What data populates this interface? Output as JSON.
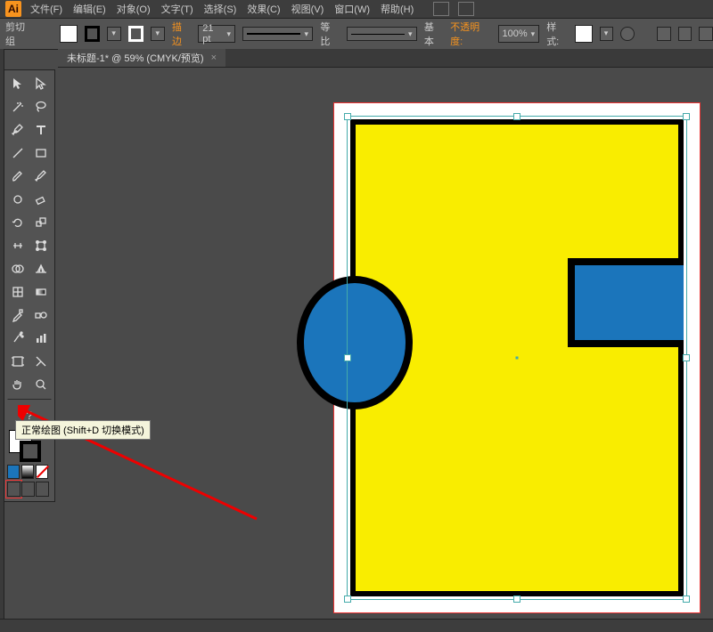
{
  "colors": {
    "accent": "#f7931e",
    "artboard_outline": "#e33",
    "shape_fill_yellow": "#f9ed00",
    "shape_fill_blue": "#1b75bb",
    "shape_stroke": "#000000"
  },
  "menubar": {
    "logo_text": "Ai",
    "items": [
      "文件(F)",
      "编辑(E)",
      "对象(O)",
      "文字(T)",
      "选择(S)",
      "效果(C)",
      "视图(V)",
      "窗口(W)",
      "帮助(H)"
    ]
  },
  "optbar": {
    "group_label": "剪切组",
    "stroke_label": "描边",
    "stroke_weight": "21 pt",
    "uniform_label": "等比",
    "basic_label": "基本",
    "opacity_label": "不透明度:",
    "opacity_value": "100%",
    "style_label": "样式:"
  },
  "document_tab": {
    "title": "未标题-1* @ 59% (CMYK/预览)"
  },
  "tooltip": {
    "text": "正常绘图 (Shift+D 切换模式)"
  },
  "tools_left": [
    "selection",
    "direct-selection",
    "magic-wand",
    "lasso",
    "pen",
    "type",
    "line",
    "rectangle",
    "paintbrush",
    "pencil",
    "blob-brush",
    "eraser",
    "rotate",
    "scale",
    "width",
    "free-transform",
    "shape-builder",
    "perspective-grid",
    "mesh",
    "gradient",
    "eyedropper",
    "blend",
    "symbol-sprayer",
    "column-graph",
    "artboard",
    "slice",
    "hand",
    "zoom"
  ],
  "draw_modes": {
    "items": [
      "draw-normal",
      "draw-behind",
      "draw-inside"
    ],
    "active_index": 0
  },
  "canvas": {
    "zoom_percent": 59,
    "color_mode": "CMYK",
    "view_mode": "预览"
  }
}
